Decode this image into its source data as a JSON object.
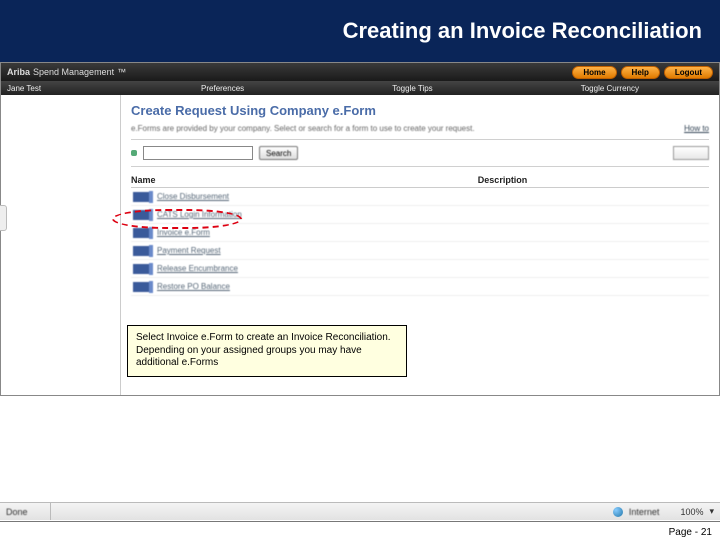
{
  "slide": {
    "title": "Creating an Invoice Reconciliation",
    "page_label": "Page - 21"
  },
  "brand": {
    "name": "Ariba",
    "suffix": "Spend Management",
    "buttons": {
      "home": "Home",
      "help": "Help",
      "logout": "Logout"
    }
  },
  "nav": {
    "user": "Jane Test",
    "preferences": "Preferences",
    "toggle_tips": "Toggle Tips",
    "toggle_currency": "Toggle Currency"
  },
  "page": {
    "title": "Create Request Using Company e.Form",
    "intro": "e.Forms are provided by your company. Select or search for a form to use to create your request.",
    "howto": "How to",
    "search_btn": "Search",
    "col_name": "Name",
    "col_desc": "Description"
  },
  "items": [
    {
      "label": "Close Disbursement"
    },
    {
      "label": "CATS Login Information"
    },
    {
      "label": "Invoice e.Form"
    },
    {
      "label": "Payment Request"
    },
    {
      "label": "Release Encumbrance"
    },
    {
      "label": "Restore PO Balance"
    }
  ],
  "callout": {
    "text": "Select Invoice e.Form to create an Invoice Reconciliation. Depending on your assigned groups you may have additional e.Forms"
  },
  "status": {
    "left": "Done",
    "net": "Internet",
    "zoom": "100%"
  }
}
